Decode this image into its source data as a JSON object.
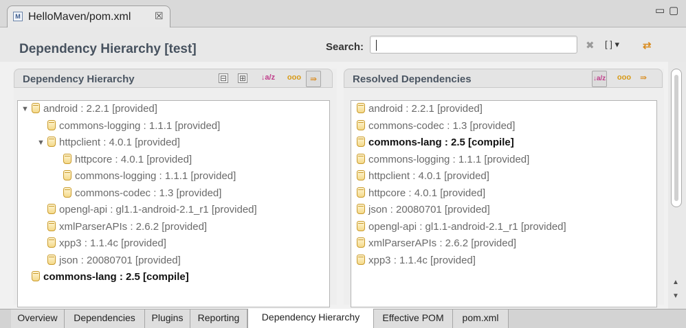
{
  "editor_tab": {
    "icon": "M",
    "title": "HelloMaven/pom.xml",
    "close_glyph": "☒"
  },
  "window_controls": {
    "minimize": "▭",
    "maximize": "▢"
  },
  "header": {
    "title": "Dependency Hierarchy [test]",
    "search_label": "Search:",
    "search_value": "",
    "clear_glyph": "✖",
    "filter_label": "[ ] ▾",
    "sync_glyph": "⇄"
  },
  "left_section": {
    "title": "Dependency Hierarchy",
    "tools": {
      "collapse": "⊟",
      "expand": "⊞",
      "sort": "↓a/z",
      "groups": "ooo",
      "filter": "⇛"
    },
    "tree": [
      {
        "label": "android : 2.2.1 [provided]",
        "level": 0,
        "expanded": true,
        "bold": false
      },
      {
        "label": "commons-logging : 1.1.1 [provided]",
        "level": 1,
        "expanded": false,
        "bold": false
      },
      {
        "label": "httpclient : 4.0.1 [provided]",
        "level": 1,
        "expanded": true,
        "bold": false
      },
      {
        "label": "httpcore : 4.0.1 [provided]",
        "level": 2,
        "expanded": false,
        "bold": false
      },
      {
        "label": "commons-logging : 1.1.1 [provided]",
        "level": 2,
        "expanded": false,
        "bold": false
      },
      {
        "label": "commons-codec : 1.3 [provided]",
        "level": 2,
        "expanded": false,
        "bold": false
      },
      {
        "label": "opengl-api : gl1.1-android-2.1_r1 [provided]",
        "level": 1,
        "expanded": false,
        "bold": false
      },
      {
        "label": "xmlParserAPIs : 2.6.2 [provided]",
        "level": 1,
        "expanded": false,
        "bold": false
      },
      {
        "label": "xpp3 : 1.1.4c [provided]",
        "level": 1,
        "expanded": false,
        "bold": false
      },
      {
        "label": "json : 20080701 [provided]",
        "level": 1,
        "expanded": false,
        "bold": false
      },
      {
        "label": "commons-lang : 2.5 [compile]",
        "level": 0,
        "expanded": false,
        "bold": true
      }
    ]
  },
  "right_section": {
    "title": "Resolved Dependencies",
    "tools": {
      "sort": "↓a/z",
      "groups": "ooo",
      "filter": "⇛"
    },
    "list": [
      {
        "label": "android : 2.2.1 [provided]",
        "bold": false
      },
      {
        "label": "commons-codec : 1.3 [provided]",
        "bold": false
      },
      {
        "label": "commons-lang : 2.5 [compile]",
        "bold": true
      },
      {
        "label": "commons-logging : 1.1.1 [provided]",
        "bold": false
      },
      {
        "label": "httpclient : 4.0.1 [provided]",
        "bold": false
      },
      {
        "label": "httpcore : 4.0.1 [provided]",
        "bold": false
      },
      {
        "label": "json : 20080701 [provided]",
        "bold": false
      },
      {
        "label": "opengl-api : gl1.1-android-2.1_r1 [provided]",
        "bold": false
      },
      {
        "label": "xmlParserAPIs : 2.6.2 [provided]",
        "bold": false
      },
      {
        "label": "xpp3 : 1.1.4c [provided]",
        "bold": false
      }
    ]
  },
  "scrollbar": {
    "up": "▲",
    "down": "▼"
  },
  "bottom_tabs": [
    {
      "label": "Overview",
      "active": false
    },
    {
      "label": "Dependencies",
      "active": false
    },
    {
      "label": "Plugins",
      "active": false
    },
    {
      "label": "Reporting",
      "active": false
    },
    {
      "label": "Dependency Hierarchy",
      "active": true
    },
    {
      "label": "Effective POM",
      "active": false
    },
    {
      "label": "pom.xml",
      "active": false
    }
  ],
  "colors": {
    "jar_icon": "#c99a2a",
    "title_text": "#47525f",
    "section_title": "#4b5663"
  }
}
